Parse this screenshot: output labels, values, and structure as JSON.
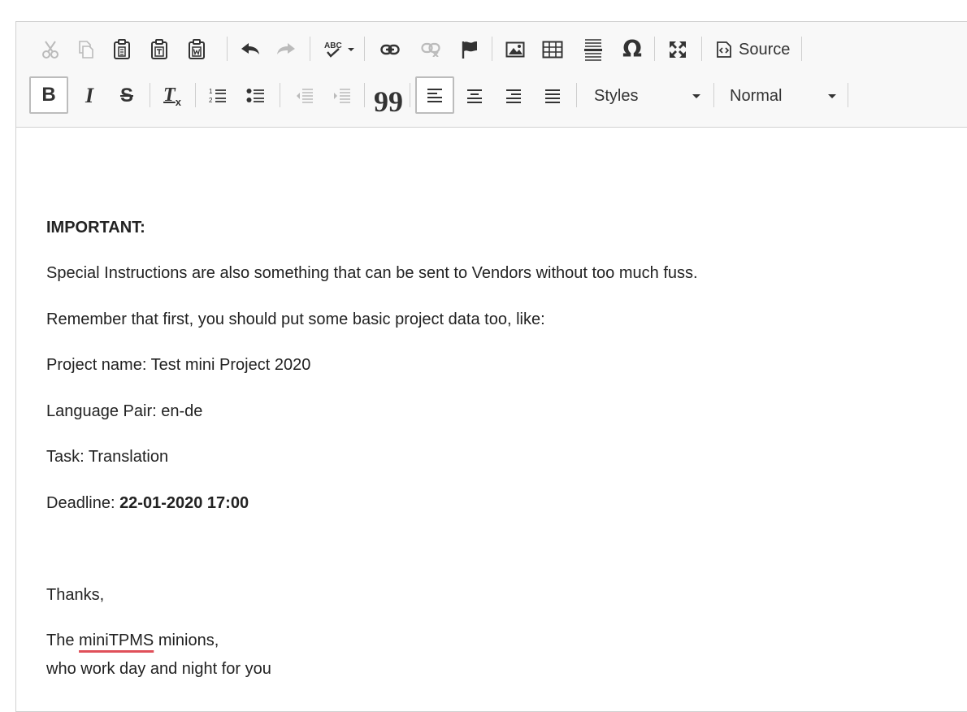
{
  "toolbar": {
    "source_label": "Source",
    "styles_label": "Styles",
    "format_label": "Normal",
    "spell_label": "ABC"
  },
  "icons": {
    "cut": "scissors",
    "copy": "copy",
    "paste": "clipboard",
    "paste_text": "clipboard-text",
    "paste_word": "clipboard-word",
    "undo": "arrow-left",
    "redo": "arrow-right",
    "spellcheck": "abc-check",
    "link": "link",
    "unlink": "unlink",
    "anchor": "flag",
    "image": "image",
    "table": "table",
    "horizontal_rule": "lines",
    "special_char": "omega",
    "maximize": "expand",
    "source": "code-doc",
    "bold": "B",
    "italic": "I",
    "strike": "S",
    "remove_format": "Tx",
    "numbered_list": "ol",
    "bulleted_list": "ul",
    "outdent": "outdent",
    "indent": "indent",
    "blockquote": "quote",
    "align_left": "align-left",
    "align_center": "align-center",
    "align_right": "align-right",
    "justify": "align-justify"
  },
  "content": {
    "heading": "IMPORTANT:",
    "line1": "Special Instructions are also something that can be sent to Vendors without too much fuss.",
    "line2": "Remember that first, you should put some basic project data too, like:",
    "project_name": "Project name: Test mini Project 2020",
    "language_pair": "Language Pair: en-de",
    "task": "Task: Translation",
    "deadline_label": "Deadline: ",
    "deadline_value": "22-01-2020 17:00",
    "thanks": "Thanks,",
    "sign_pre": "The ",
    "sign_brand": "miniTPMS",
    "sign_post": " minions,",
    "sign_line2": "who work day and night for you"
  },
  "colors": {
    "toolbar_bg": "#f8f8f8",
    "border": "#d1d1d1",
    "spellcheck_underline": "#e0505a"
  }
}
